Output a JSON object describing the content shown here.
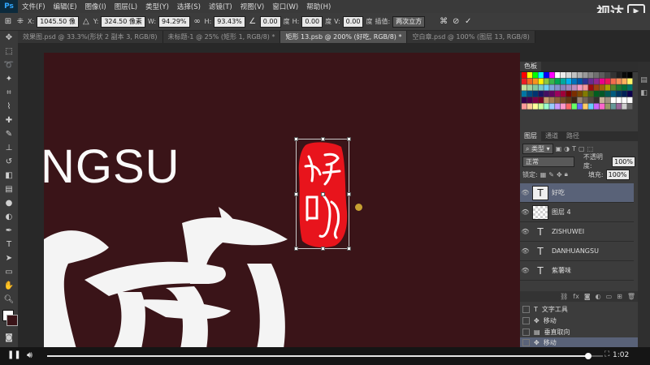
{
  "menu": {
    "logo": "Ps",
    "items": [
      "文件(F)",
      "编辑(E)",
      "图像(I)",
      "图层(L)",
      "类型(Y)",
      "选择(S)",
      "滤镜(T)",
      "视图(V)",
      "窗口(W)",
      "帮助(H)"
    ]
  },
  "brand": {
    "text": "视达",
    "icon": "play-icon"
  },
  "options": {
    "x_label": "X:",
    "x_value": "1045.50 像",
    "y_label": "Y:",
    "y_value": "324.50 像素",
    "w_label": "W:",
    "w_value": "94.29%",
    "h_label": "H:",
    "h_value": "93.43%",
    "angle_value": "0.00",
    "angle_unit": "度",
    "hskew_label": "H:",
    "hskew_value": "0.00",
    "hskew_unit": "度",
    "vskew_label": "V:",
    "vskew_value": "0.00",
    "vskew_unit": "度",
    "interp_label": "插值:",
    "interp_value": "两次立方"
  },
  "tabs": [
    {
      "label": "效果图.psd @ 33.3%(形状 2 副本 3, RGB/8)",
      "active": false
    },
    {
      "label": "未标题-1 @ 25% (矩形 1, RGB/8) *",
      "active": false
    },
    {
      "label": "矩形 13.psb @ 200% (好吃, RGB/8) *",
      "active": true
    },
    {
      "label": "空白章.psd @ 100% (图层 13, RGB/8)",
      "active": false
    }
  ],
  "canvas": {
    "big_text": "NGSU",
    "calligraphy_text": "酥",
    "seal_text": "好吃",
    "bg_color": "#3a1418",
    "seal_color": "#e8141c"
  },
  "swatches": {
    "title": "色板"
  },
  "layers_panel": {
    "tabs": [
      "图层",
      "通道",
      "路径"
    ],
    "filter_label": "类型",
    "blend_mode": "正常",
    "opacity_label": "不透明度:",
    "opacity_value": "100%",
    "lock_label": "锁定:",
    "fill_label": "填充:",
    "fill_value": "100%",
    "layers": [
      {
        "name": "好吃",
        "kind": "T",
        "selected": true
      },
      {
        "name": "图层 4",
        "kind": "raster",
        "selected": false
      },
      {
        "name": "ZISHUWEI",
        "kind": "T",
        "selected": false
      },
      {
        "name": "DANHUANGSU",
        "kind": "T",
        "selected": false
      },
      {
        "name": "紫薯味",
        "kind": "T",
        "selected": false
      }
    ]
  },
  "history": [
    {
      "name": "文字工具",
      "selected": false
    },
    {
      "name": "移动",
      "selected": false
    },
    {
      "name": "垂直取向",
      "selected": false
    },
    {
      "name": "移动",
      "selected": true
    }
  ],
  "player": {
    "time": "1:02",
    "progress": 0.973
  }
}
